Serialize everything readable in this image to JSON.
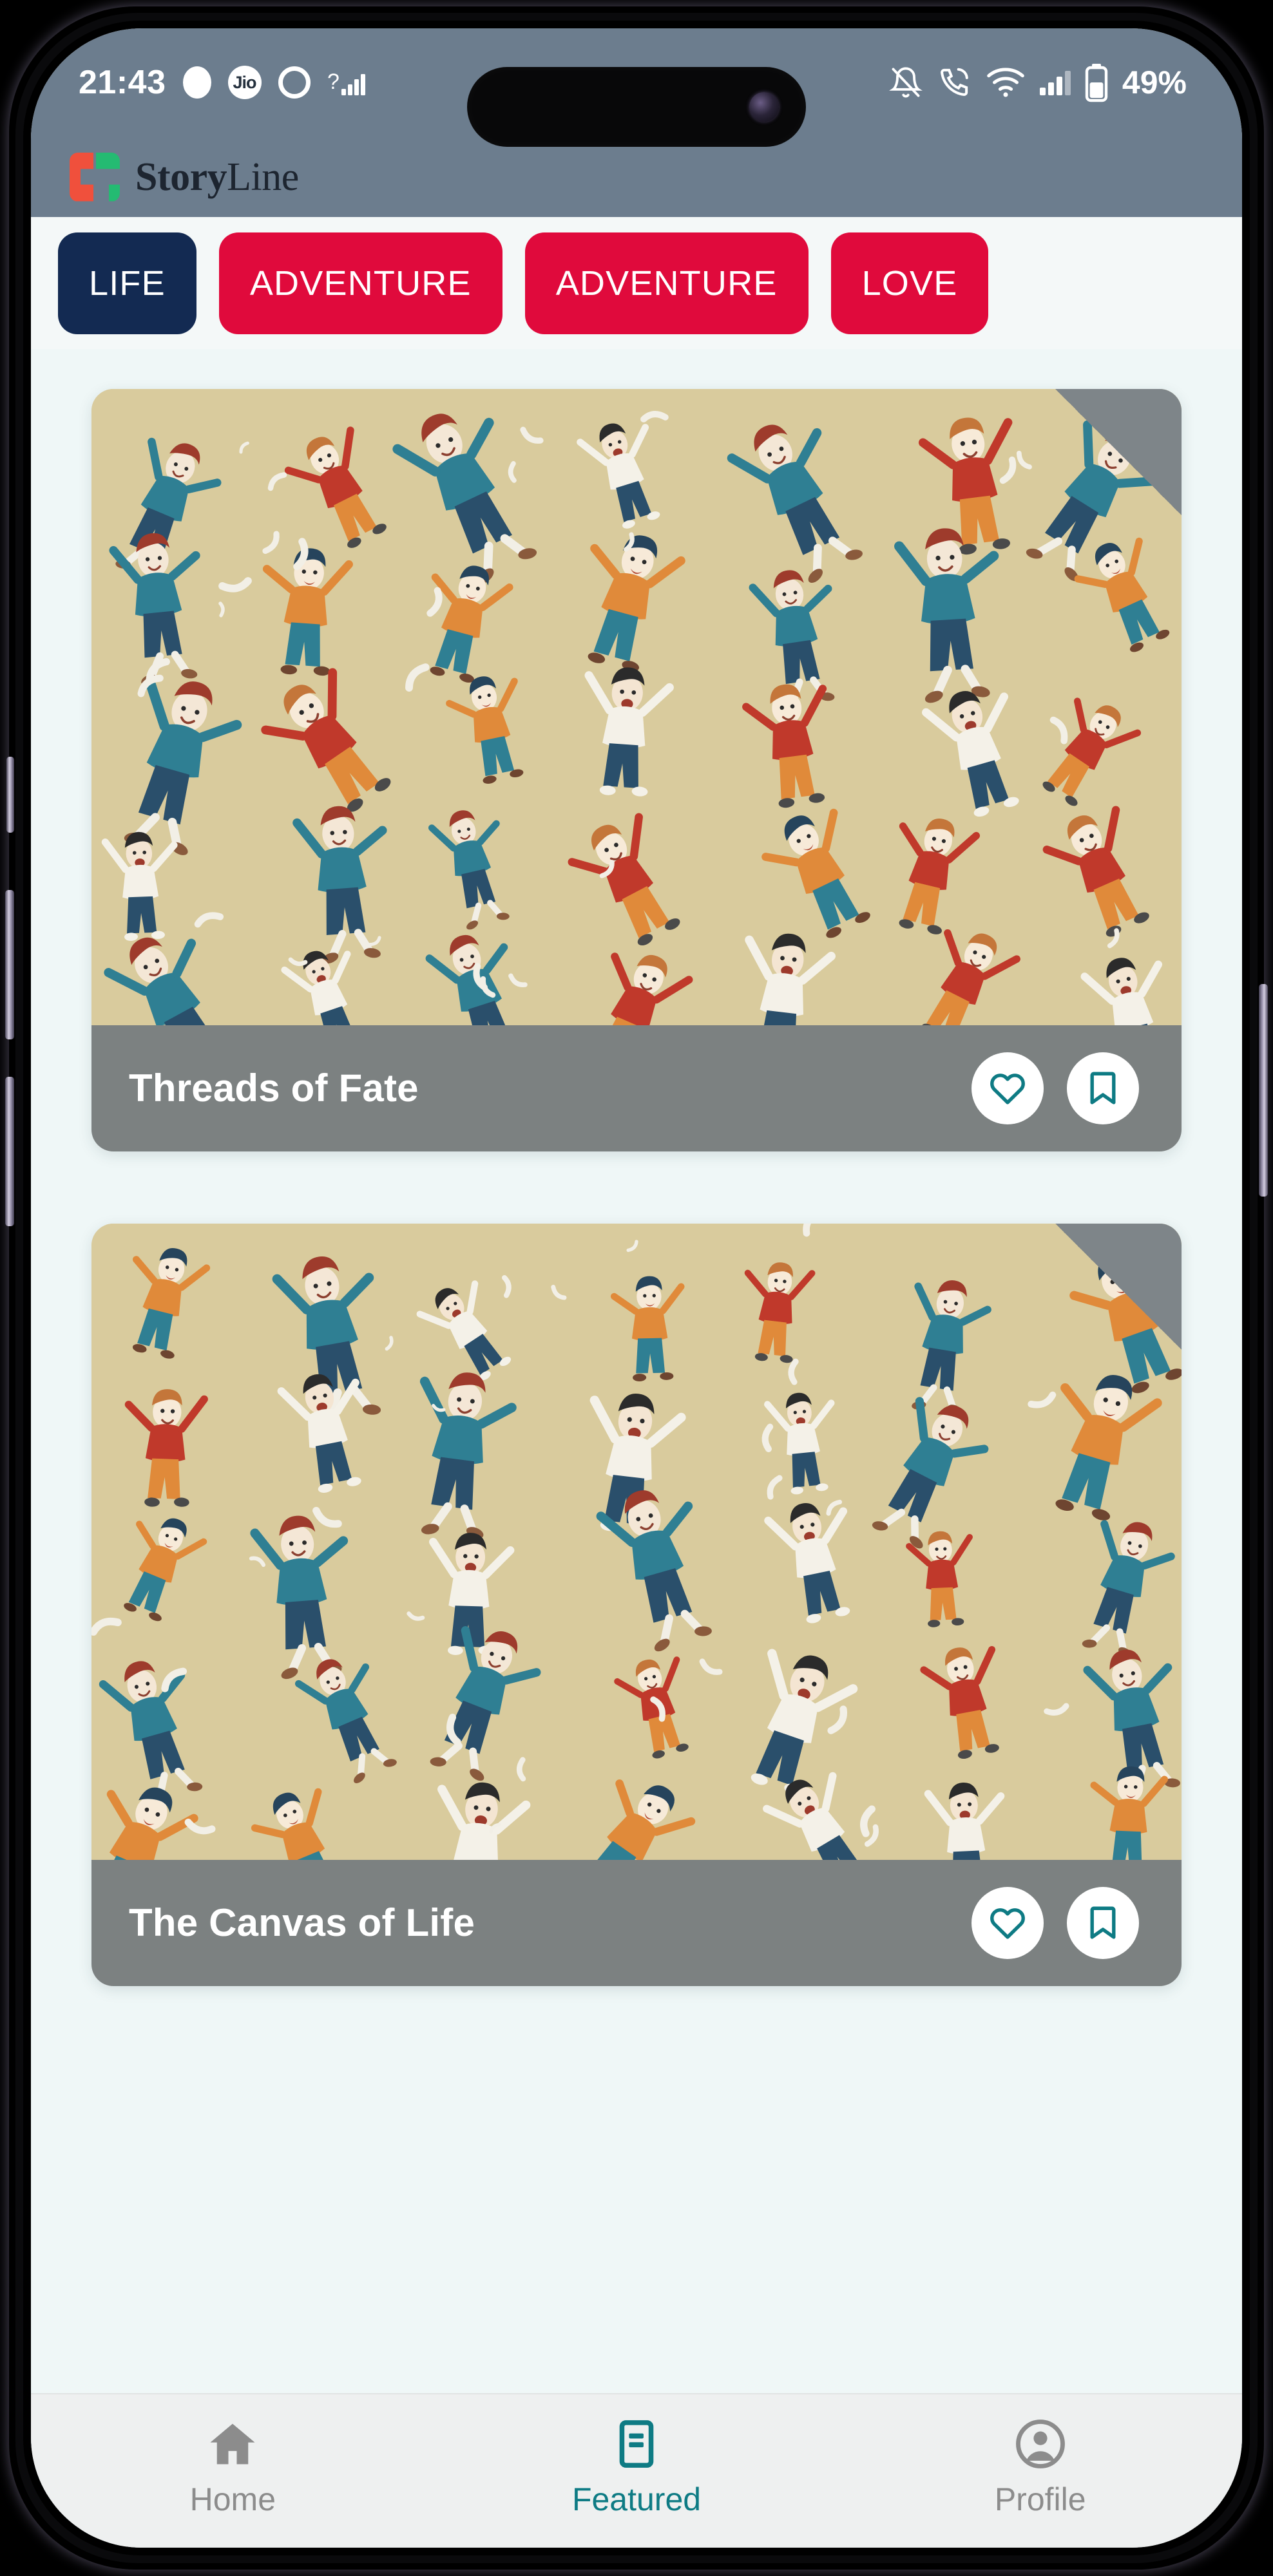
{
  "status_bar": {
    "clock": "21:43",
    "carrier_label": "Jio",
    "battery_percent": "49%",
    "icons": [
      "white-dot-icon",
      "jio-carrier-icon",
      "ring-icon",
      "sim-question-icon",
      "signal-bars-icon",
      "silent-bell-icon",
      "missed-call-icon",
      "wifi-icon",
      "signal-bars-icon",
      "battery-icon"
    ]
  },
  "app_header": {
    "brand_bold": "Story",
    "brand_light": "Line",
    "logo_left_color": "#f0503c",
    "logo_right_color": "#24bb72",
    "background_color": "#6c7d8e"
  },
  "categories": {
    "selected_index": 0,
    "selected_color": "#132a52",
    "unselected_color": "#e00a3c",
    "items": [
      {
        "label": "LIFE"
      },
      {
        "label": "ADVENTURE"
      },
      {
        "label": "ADVENTURE"
      },
      {
        "label": "LOVE"
      }
    ]
  },
  "stories": [
    {
      "title": "Threads of Fate",
      "cover_alt": "illustrated pattern of joyful dancing people on tan background",
      "like_icon": "heart-icon",
      "save_icon": "bookmark-icon"
    },
    {
      "title": "The Canvas of Life",
      "cover_alt": "illustrated pattern of joyful dancing people on tan background",
      "like_icon": "heart-icon",
      "save_icon": "bookmark-icon"
    }
  ],
  "bottom_nav": {
    "active_index": 1,
    "active_color": "#0e7b84",
    "inactive_color": "#8c8c8c",
    "items": [
      {
        "label": "Home",
        "icon": "home-icon"
      },
      {
        "label": "Featured",
        "icon": "article-icon"
      },
      {
        "label": "Profile",
        "icon": "person-circle-icon"
      }
    ]
  },
  "theme": {
    "page_background": "#eff7f7",
    "card_meta_background": "#7c8181",
    "cover_background": "#d9cb9d",
    "accent_teal": "#0e7b84"
  }
}
